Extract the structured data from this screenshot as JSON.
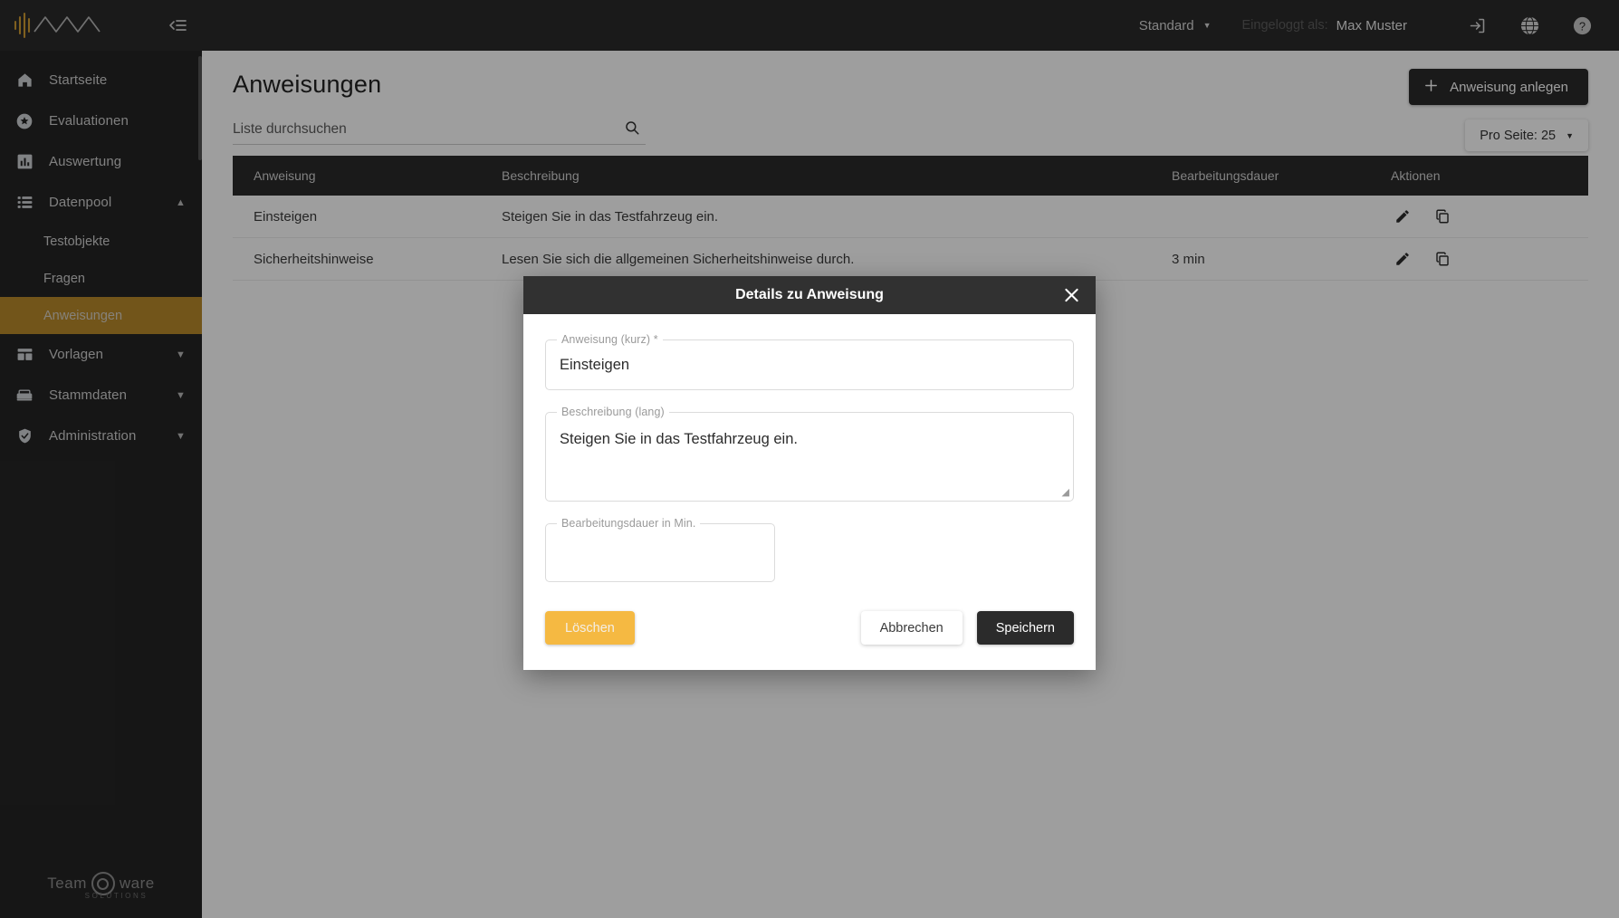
{
  "topbar": {
    "mode_select": "Standard",
    "logged_in_label": "Eingeloggt als:",
    "username": "Max Muster",
    "icons": {
      "logout": "logout-icon",
      "language": "globe-icon",
      "help": "help-icon"
    }
  },
  "sidebar": {
    "brand": "waveform-logo",
    "collapse_icon": "collapse-sidebar-icon",
    "items": [
      {
        "label": "Startseite",
        "icon": "home-icon",
        "type": "link",
        "active": false,
        "expanded": null
      },
      {
        "label": "Evaluationen",
        "icon": "star-icon",
        "type": "link",
        "active": false,
        "expanded": null
      },
      {
        "label": "Auswertung",
        "icon": "chart-icon",
        "type": "link",
        "active": false,
        "expanded": null
      },
      {
        "label": "Datenpool",
        "icon": "list-icon",
        "type": "group",
        "active": false,
        "expanded": true
      },
      {
        "label": "Testobjekte",
        "icon": "",
        "type": "sub",
        "active": false,
        "expanded": null
      },
      {
        "label": "Fragen",
        "icon": "",
        "type": "sub",
        "active": false,
        "expanded": null
      },
      {
        "label": "Anweisungen",
        "icon": "",
        "type": "sub",
        "active": true,
        "expanded": null
      },
      {
        "label": "Vorlagen",
        "icon": "template-icon",
        "type": "group",
        "active": false,
        "expanded": false
      },
      {
        "label": "Stammdaten",
        "icon": "database-icon",
        "type": "group",
        "active": false,
        "expanded": false
      },
      {
        "label": "Administration",
        "icon": "shield-icon",
        "type": "group",
        "active": false,
        "expanded": false
      }
    ],
    "footer_logo": {
      "left": "Team",
      "right": "ware",
      "subtitle": "SOLUTIONS"
    }
  },
  "page": {
    "title": "Anweisungen",
    "search_placeholder": "Liste durchsuchen",
    "search_value": "",
    "search_icon": "search-icon",
    "create_button": "Anweisung anlegen",
    "create_icon": "plus-icon",
    "per_page_button": "Pro Seite: 25"
  },
  "table": {
    "columns": [
      "Anweisung",
      "Beschreibung",
      "Bearbeitungsdauer",
      "Aktionen"
    ],
    "rows": [
      {
        "anweisung": "Einsteigen",
        "beschreibung": "Steigen Sie in das Testfahrzeug ein.",
        "dauer": "",
        "actions": [
          "edit-icon",
          "copy-icon"
        ]
      },
      {
        "anweisung": "Sicherheitshinweise",
        "beschreibung": "Lesen Sie sich die allgemeinen Sicherheitshinweise durch.",
        "dauer": "3 min",
        "actions": [
          "edit-icon",
          "copy-icon"
        ]
      }
    ]
  },
  "modal": {
    "title": "Details zu Anweisung",
    "close_icon": "close-icon",
    "fields": {
      "short": {
        "label": "Anweisung (kurz)",
        "required_marker": "*",
        "value": "Einsteigen",
        "placeholder": ""
      },
      "long": {
        "label": "Beschreibung (lang)",
        "required_marker": "",
        "value": "Steigen Sie in das Testfahrzeug ein.",
        "placeholder": ""
      },
      "duration": {
        "label": "Bearbeitungsdauer in Min.",
        "required_marker": "",
        "value": "",
        "placeholder": ""
      }
    },
    "buttons": {
      "delete": "Löschen",
      "cancel": "Abbrechen",
      "save": "Speichern"
    }
  },
  "colors": {
    "accent": "#b8892a",
    "accent_button": "#f5b942",
    "dark": "#2b2b2b",
    "sidebar": "#252525"
  }
}
